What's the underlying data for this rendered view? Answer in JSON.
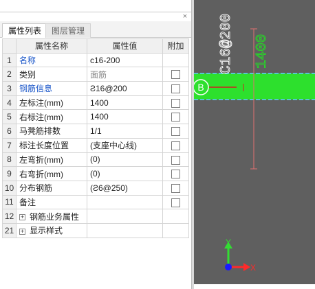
{
  "panel": {
    "close_glyph": "×",
    "tabs": [
      {
        "label": "属性列表",
        "active": true
      },
      {
        "label": "图层管理",
        "active": false
      }
    ],
    "columns": {
      "num": "",
      "name": "属性名称",
      "value": "属性值",
      "extra": "附加"
    },
    "rows": [
      {
        "num": "1",
        "name": "名称",
        "value": "c16-200",
        "name_color": "blue",
        "value_style": "normal",
        "checkbox": false,
        "expander": false
      },
      {
        "num": "2",
        "name": "类别",
        "value": "面筋",
        "name_color": "normal",
        "value_style": "grey",
        "checkbox": true,
        "expander": false
      },
      {
        "num": "3",
        "name": "钢筋信息",
        "value": "Ƨ16@200",
        "name_color": "blue",
        "value_style": "normal",
        "checkbox": true,
        "expander": false
      },
      {
        "num": "4",
        "name": "左标注(mm)",
        "value": "1400",
        "name_color": "normal",
        "value_style": "normal",
        "checkbox": true,
        "expander": false
      },
      {
        "num": "5",
        "name": "右标注(mm)",
        "value": "1400",
        "name_color": "normal",
        "value_style": "normal",
        "checkbox": true,
        "expander": false
      },
      {
        "num": "6",
        "name": "马凳筋排数",
        "value": "1/1",
        "name_color": "normal",
        "value_style": "normal",
        "checkbox": true,
        "expander": false
      },
      {
        "num": "7",
        "name": "标注长度位置",
        "value": "(支座中心线)",
        "name_color": "normal",
        "value_style": "normal",
        "checkbox": true,
        "expander": false
      },
      {
        "num": "8",
        "name": "左弯折(mm)",
        "value": "(0)",
        "name_color": "normal",
        "value_style": "normal",
        "checkbox": true,
        "expander": false
      },
      {
        "num": "9",
        "name": "右弯折(mm)",
        "value": "(0)",
        "name_color": "normal",
        "value_style": "normal",
        "checkbox": true,
        "expander": false
      },
      {
        "num": "10",
        "name": "分布钢筋",
        "value": "(Ƨ6@250)",
        "name_color": "normal",
        "value_style": "normal",
        "checkbox": true,
        "expander": false
      },
      {
        "num": "11",
        "name": "备注",
        "value": "",
        "name_color": "normal",
        "value_style": "normal",
        "checkbox": true,
        "expander": false
      },
      {
        "num": "12",
        "name": "钢筋业务属性",
        "value": "",
        "name_color": "normal",
        "value_style": "normal",
        "checkbox": false,
        "expander": true
      },
      {
        "num": "21",
        "name": "显示样式",
        "value": "",
        "name_color": "normal",
        "value_style": "normal",
        "checkbox": false,
        "expander": true
      }
    ],
    "expander_glyph": "+"
  },
  "canvas": {
    "background": "#5f5f5f",
    "slab_color": "#2de02d",
    "rebar_label": "C16@200",
    "dimension_label": "1400",
    "axis_label": "B",
    "ucs_x_label": "X",
    "ucs_y_label": "Y",
    "colors": {
      "slab_edge": "#5ad4ff",
      "rebar": "#d02020",
      "dimension": "#22e222",
      "text": "#ffffff",
      "dim_line": "#e07070",
      "ucs_x": "#ff2a2a",
      "ucs_y": "#33dd33",
      "ucs_origin": "#1a1aff"
    }
  }
}
